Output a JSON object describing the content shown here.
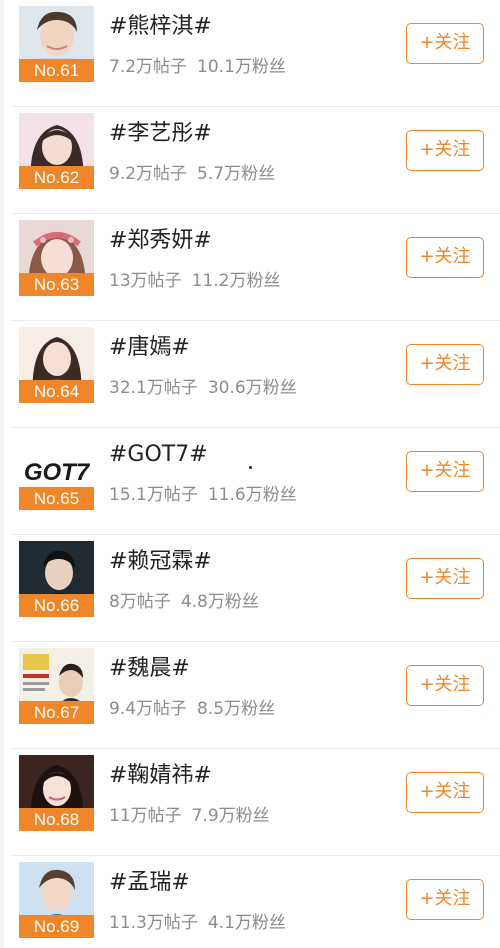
{
  "topics": [
    {
      "rank": "No.61",
      "title": "#熊梓淇#",
      "posts": "7.2万帖子",
      "fans": "10.1万粉丝",
      "follow_label": "+关注",
      "avatar": "portrait-male-light"
    },
    {
      "rank": "No.62",
      "title": "#李艺彤#",
      "posts": "9.2万帖子",
      "fans": "5.7万粉丝",
      "follow_label": "+关注",
      "avatar": "portrait-female-pink"
    },
    {
      "rank": "No.63",
      "title": "#郑秀妍#",
      "posts": "13万帖子",
      "fans": "11.2万粉丝",
      "follow_label": "+关注",
      "avatar": "portrait-female-headband"
    },
    {
      "rank": "No.64",
      "title": "#唐嫣#",
      "posts": "32.1万帖子",
      "fans": "30.6万粉丝",
      "follow_label": "+关注",
      "avatar": "portrait-female-red"
    },
    {
      "rank": "No.65",
      "title": "#GOT7#",
      "posts": "15.1万帖子",
      "fans": "11.6万粉丝",
      "follow_label": "+关注",
      "avatar": "got7-logo",
      "logo_text": "GOT7"
    },
    {
      "rank": "No.66",
      "title": "#赖冠霖#",
      "posts": "8万帖子",
      "fans": "4.8万粉丝",
      "follow_label": "+关注",
      "avatar": "portrait-male-dark"
    },
    {
      "rank": "No.67",
      "title": "#魏晨#",
      "posts": "9.4万帖子",
      "fans": "8.5万粉丝",
      "follow_label": "+关注",
      "avatar": "poster-male"
    },
    {
      "rank": "No.68",
      "title": "#鞠婧祎#",
      "posts": "11万帖子",
      "fans": "7.9万粉丝",
      "follow_label": "+关注",
      "avatar": "portrait-female-dark"
    },
    {
      "rank": "No.69",
      "title": "#孟瑞#",
      "posts": "11.3万帖子",
      "fans": "4.1万粉丝",
      "follow_label": "+关注",
      "avatar": "portrait-male-blue"
    }
  ],
  "colors": {
    "accent": "#f0862a",
    "title_text": "#222222",
    "stats_text": "#8c8c8c",
    "separator": "#ececec"
  }
}
